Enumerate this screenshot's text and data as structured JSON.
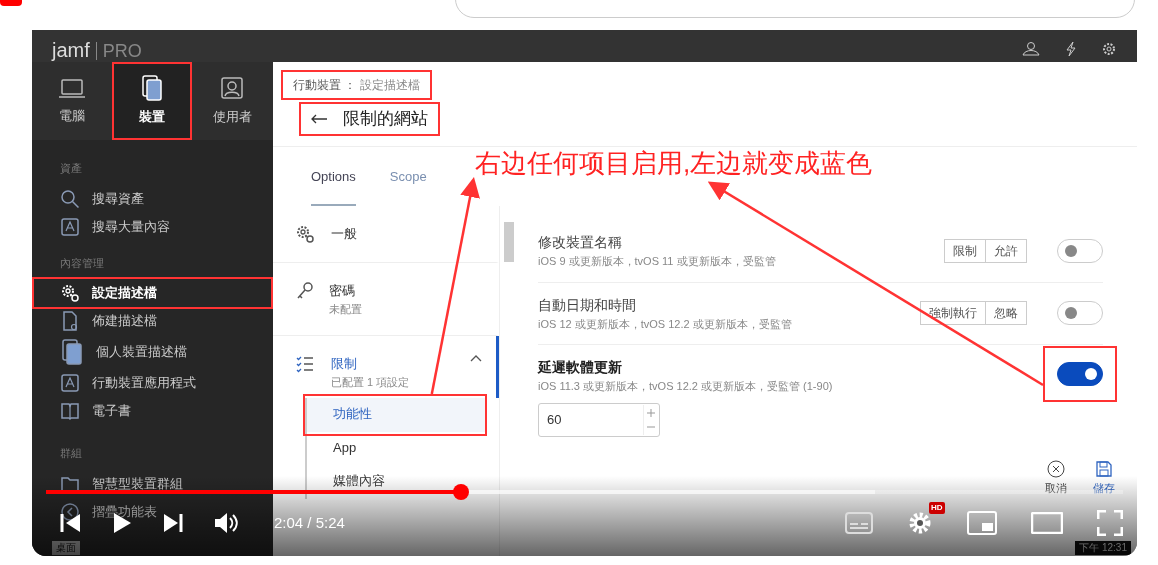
{
  "video": {
    "app": {
      "logo": "jamf",
      "edition": "PRO",
      "nav_tabs": [
        {
          "label": "電腦",
          "selected": false
        },
        {
          "label": "裝置",
          "selected": true
        },
        {
          "label": "使用者",
          "selected": false
        }
      ],
      "sidebar_sections": [
        {
          "heading": "資產",
          "items": [
            {
              "label": "搜尋資產",
              "selected": false
            },
            {
              "label": "搜尋大量內容",
              "selected": false
            }
          ]
        },
        {
          "heading": "內容管理",
          "items": [
            {
              "label": "設定描述檔",
              "selected": true
            },
            {
              "label": "佈建描述檔",
              "selected": false
            },
            {
              "label": "個人裝置描述檔",
              "selected": false
            },
            {
              "label": "行動裝置應用程式",
              "selected": false
            },
            {
              "label": "電子書",
              "selected": false
            }
          ]
        },
        {
          "heading": "群組",
          "items": [
            {
              "label": "智慧型裝置群組",
              "selected": false
            },
            {
              "label": "摺疊功能表",
              "selected": false
            }
          ]
        }
      ],
      "breadcrumb": {
        "section": "行動裝置",
        "separator": "：",
        "page": "設定描述檔"
      },
      "title": "限制的網站",
      "tabs": [
        {
          "label": "Options",
          "selected": true
        },
        {
          "label": "Scope",
          "selected": false
        }
      ],
      "payloads": [
        {
          "label": "一般",
          "configured": false
        },
        {
          "label": "密碼",
          "status": "未配置",
          "configured": false
        },
        {
          "label": "限制",
          "status": "已配置 1 項設定",
          "configured": true,
          "expanded": true,
          "children": [
            {
              "label": "功能性",
              "selected": true
            },
            {
              "label": "App",
              "selected": false
            },
            {
              "label": "媒體內容",
              "selected": false
            }
          ]
        }
      ],
      "settings": [
        {
          "kind": "choice",
          "title": "修改裝置名稱",
          "subtitle": "iOS 9 或更新版本，tvOS 11 或更新版本，受監管",
          "options": [
            "限制",
            "允許"
          ],
          "on": false
        },
        {
          "kind": "choice",
          "title": "自動日期和時間",
          "subtitle": "iOS 12 或更新版本，tvOS 12.2 或更新版本，受監管",
          "options": [
            "強制執行",
            "忽略"
          ],
          "on": false
        },
        {
          "kind": "number",
          "title": "延遲軟體更新",
          "subtitle": "iOS 11.3 或更新版本，tvOS 12.2 或更新版本，受監管 (1-90)",
          "value": "60",
          "on": true
        }
      ],
      "footer_buttons": [
        {
          "label": "取消",
          "kind": "cancel"
        },
        {
          "label": "儲存",
          "kind": "save"
        }
      ]
    },
    "annotation": "右边任何项目启用,左边就变成蓝色",
    "taskbar": {
      "folder": "桌面",
      "clock": "下午 12:31"
    }
  },
  "player": {
    "progress": {
      "level": 0.385
    },
    "buffer": {
      "level": 0.77
    },
    "time": "2:04 / 5:24",
    "quality_badge": "HD"
  }
}
